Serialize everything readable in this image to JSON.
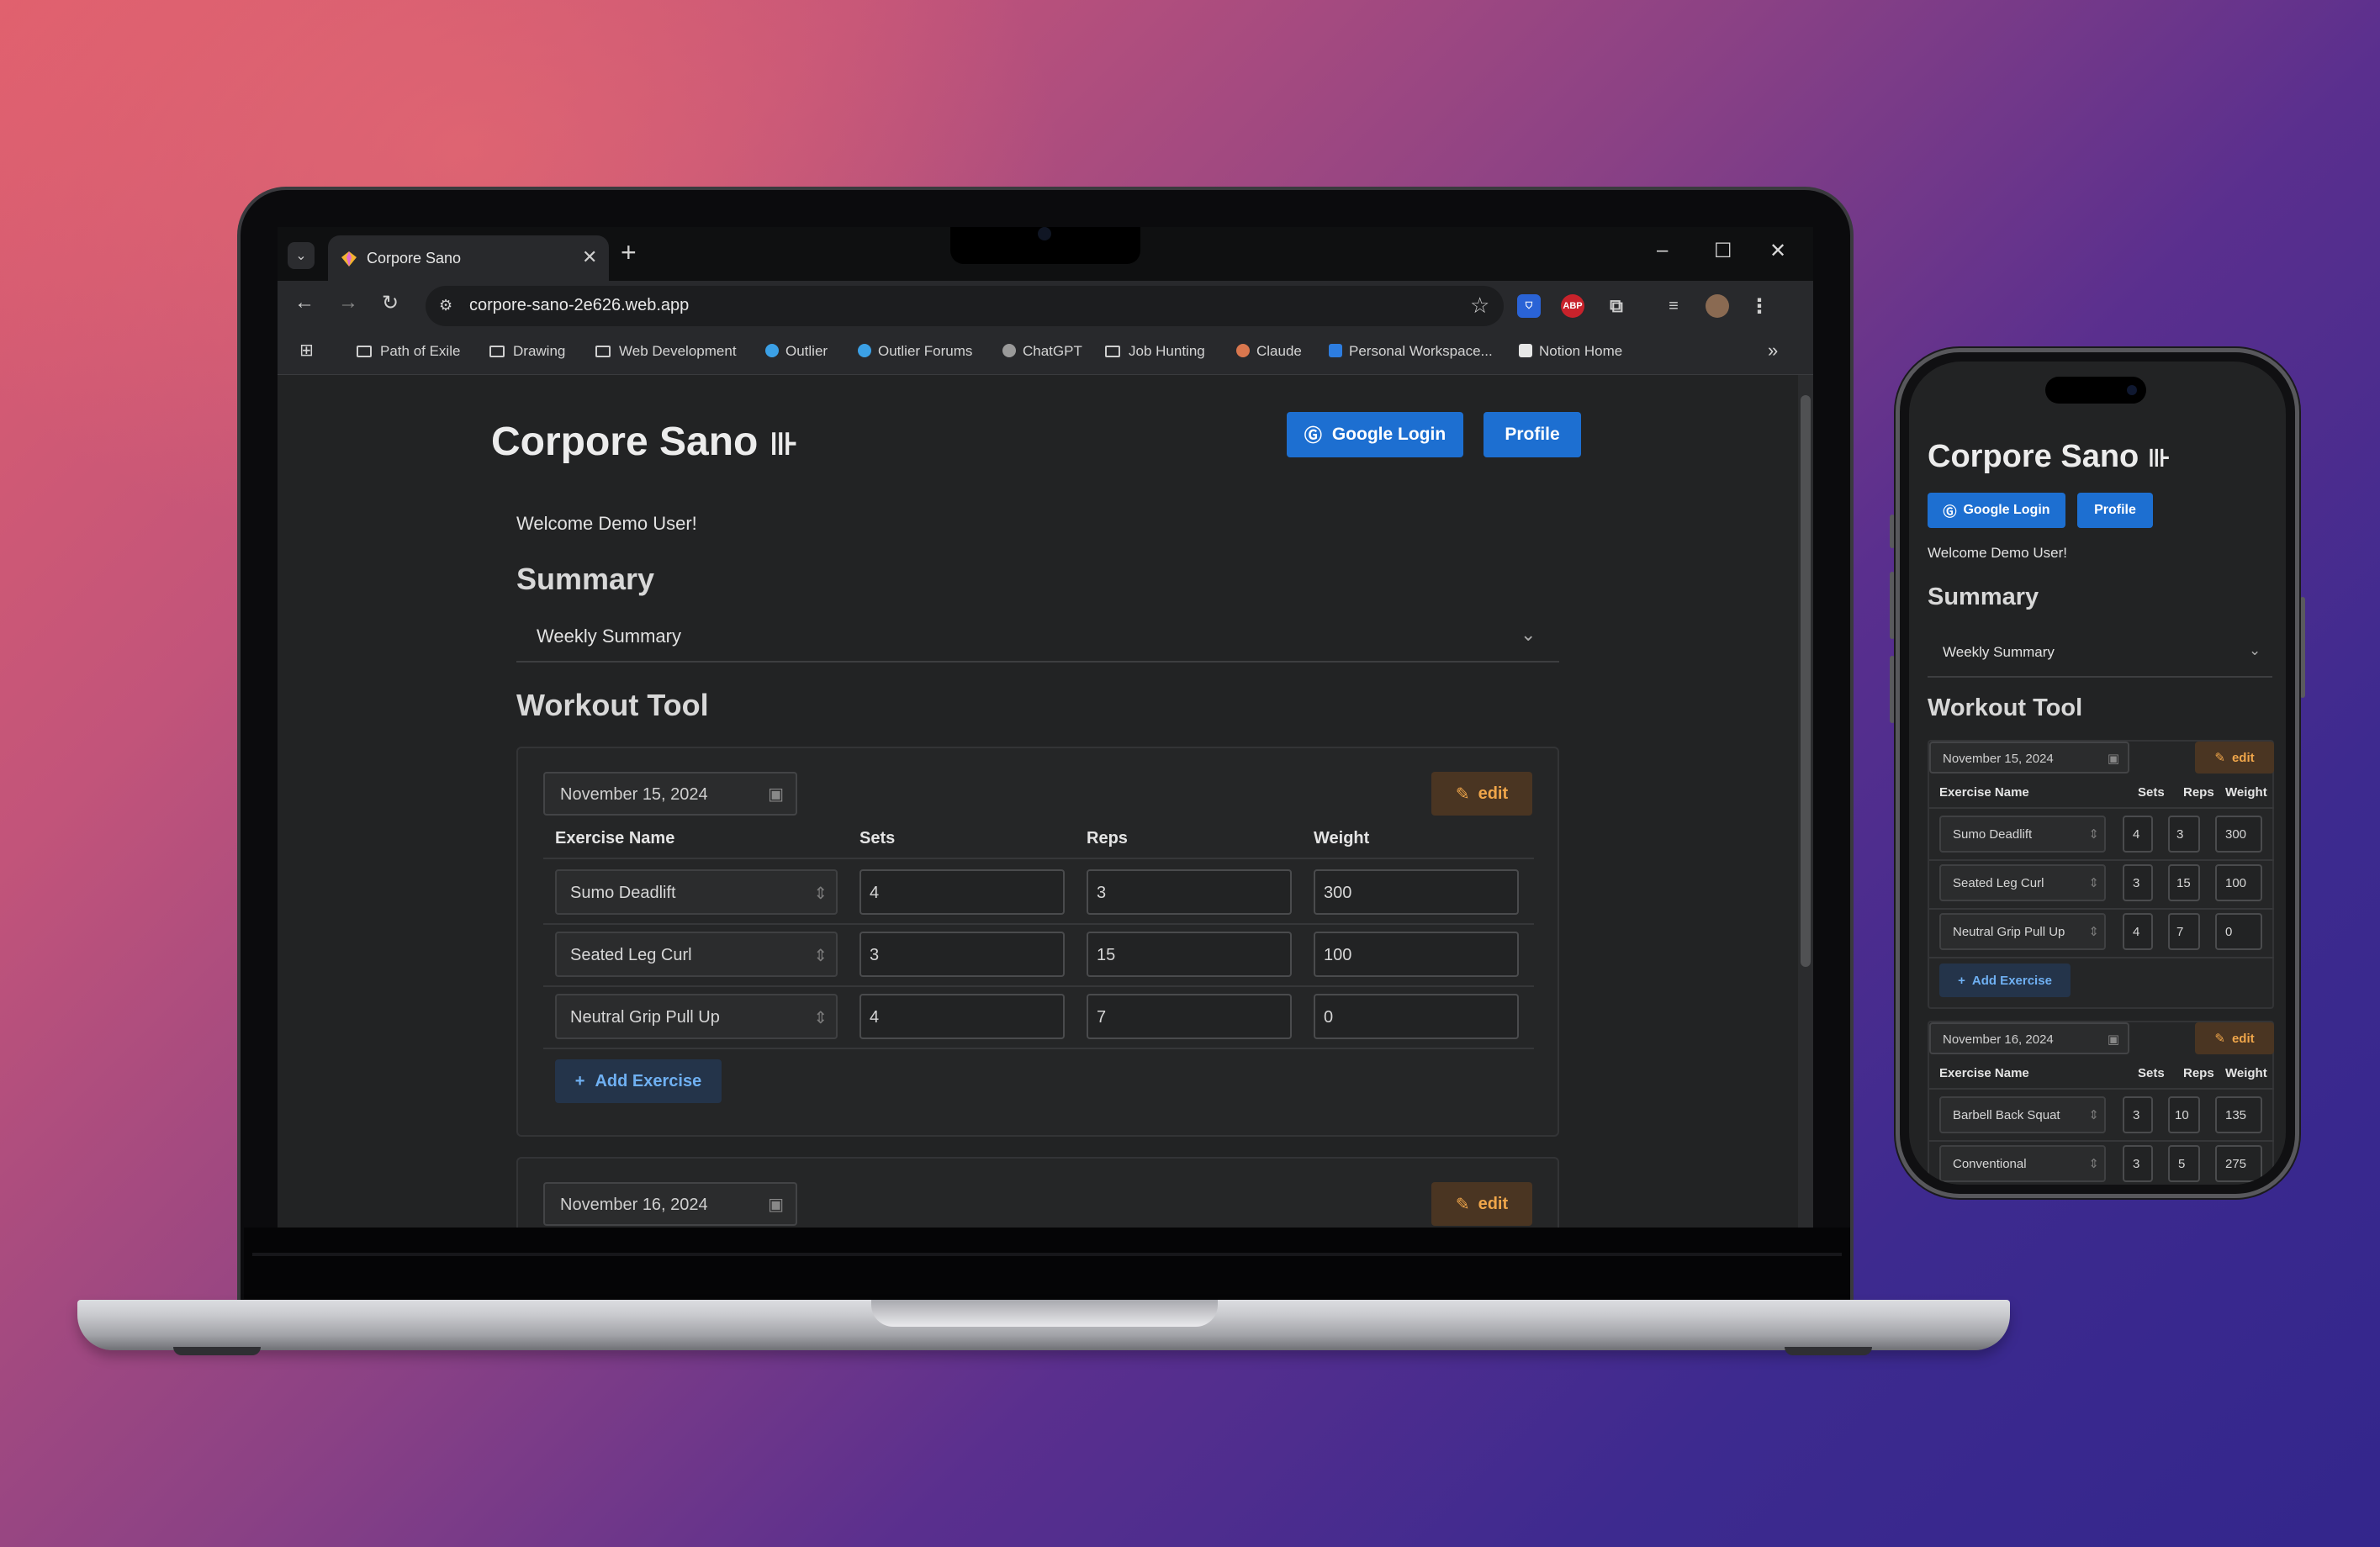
{
  "browser": {
    "tab_title": "Corpore Sano",
    "url": "corpore-sano-2e626.web.app",
    "bookmarks": [
      "Path of Exile",
      "Drawing",
      "Web Development",
      "Outlier",
      "Outlier Forums",
      "ChatGPT",
      "Job Hunting",
      "Claude",
      "Personal Workspace...",
      "Notion Home"
    ]
  },
  "app": {
    "title": "Corpore Sano",
    "google_login": "Google Login",
    "profile": "Profile",
    "welcome": "Welcome Demo User!",
    "summary_heading": "Summary",
    "weekly_summary": "Weekly Summary",
    "workout_heading": "Workout Tool",
    "edit_label": "edit",
    "add_exercise": "Add Exercise",
    "columns": {
      "name": "Exercise Name",
      "sets": "Sets",
      "reps": "Reps",
      "weight": "Weight"
    },
    "workouts": [
      {
        "date": "November 15, 2024",
        "exercises": [
          {
            "name": "Sumo Deadlift",
            "sets": "4",
            "reps": "3",
            "weight": "300"
          },
          {
            "name": "Seated Leg Curl",
            "sets": "3",
            "reps": "15",
            "weight": "100"
          },
          {
            "name": "Neutral Grip Pull Up",
            "sets": "4",
            "reps": "7",
            "weight": "0"
          }
        ]
      },
      {
        "date": "November 16, 2024",
        "exercises": [
          {
            "name": "Barbell Back Squat",
            "sets": "3",
            "reps": "10",
            "weight": "135"
          },
          {
            "name": "Conventional",
            "sets": "3",
            "reps": "5",
            "weight": "275"
          }
        ]
      }
    ]
  },
  "colors": {
    "primary": "#1d6fd1",
    "edit_bg": "#4a3522",
    "edit_fg": "#f0a64a",
    "add_fg": "#6fb0f2",
    "page_bg": "#222324"
  },
  "icons": [
    "dumbbell-icon",
    "google-icon",
    "calendar-icon",
    "edit-icon",
    "plus-icon",
    "chevron-down-icon",
    "updown-chevron-icon",
    "star-icon",
    "folder-icon"
  ]
}
